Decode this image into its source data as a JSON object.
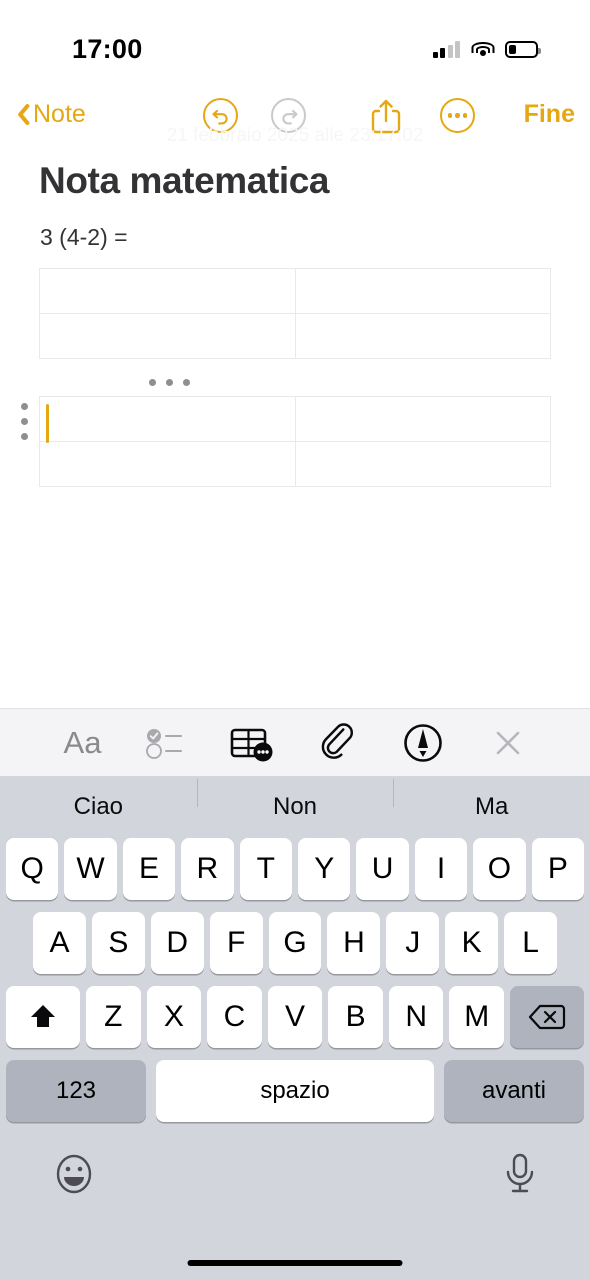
{
  "status_bar": {
    "time": "17:00",
    "signal_icon": "cellular-signal-icon",
    "wifi_icon": "wifi-icon",
    "battery_icon": "battery-low-icon",
    "signal_bars_filled": 2,
    "signal_bars_total": 4,
    "battery_percent": 20
  },
  "nav": {
    "back_label": "Note",
    "back_icon": "chevron-left-icon",
    "undo_icon": "undo-arrow-icon",
    "redo_icon": "redo-arrow-icon",
    "share_icon": "share-square-up-arrow-icon",
    "more_icon": "ellipsis-circle-icon",
    "done_label": "Fine",
    "accent_color": "#e5a812",
    "disabled_color": "#c9c9cb"
  },
  "note": {
    "date": "21 febbraio 2025 alle 23:17:02",
    "title": "Nota matematica",
    "body_line": "3 (4-2) =",
    "tables": [
      {
        "name": "table-1",
        "rows": [
          [
            "",
            ""
          ],
          [
            "",
            ""
          ]
        ]
      },
      {
        "name": "table-2",
        "rows": [
          [
            "",
            ""
          ],
          [
            "",
            ""
          ]
        ]
      }
    ],
    "column_handle_icon": "table-column-handle-dots-icon",
    "row_handle_icon": "table-row-handle-dots-icon",
    "caret_color": "#e5a812",
    "table_border_color": "#e9e9eb"
  },
  "format_toolbar": {
    "items": [
      {
        "label": "Aa",
        "name": "text-format-button",
        "icon": "aa-text-format-icon",
        "state": "inactive"
      },
      {
        "label": "",
        "name": "checklist-button",
        "icon": "checklist-icon",
        "state": "inactive"
      },
      {
        "label": "",
        "name": "table-button",
        "icon": "table-options-icon",
        "state": "active"
      },
      {
        "label": "",
        "name": "attachment-button",
        "icon": "paperclip-icon",
        "state": "inactive"
      },
      {
        "label": "",
        "name": "markup-button",
        "icon": "markup-pen-circle-icon",
        "state": "inactive"
      },
      {
        "label": "",
        "name": "close-toolbar-button",
        "icon": "close-x-icon",
        "state": "inactive"
      }
    ]
  },
  "keyboard": {
    "background_color": "#d2d5db",
    "predictions": [
      "Ciao",
      "Non",
      "Ma"
    ],
    "row1": [
      "Q",
      "W",
      "E",
      "R",
      "T",
      "Y",
      "U",
      "I",
      "O",
      "P"
    ],
    "row2": [
      "A",
      "S",
      "D",
      "F",
      "G",
      "H",
      "J",
      "K",
      "L"
    ],
    "row3_letters": [
      "Z",
      "X",
      "C",
      "V",
      "B",
      "N",
      "M"
    ],
    "shift_icon": "shift-arrow-up-icon",
    "delete_icon": "backspace-delete-icon",
    "numeric_label": "123",
    "space_label": "spazio",
    "next_label": "avanti",
    "emoji_icon": "smiley-face-icon",
    "dictation_icon": "microphone-icon",
    "home_indicator": "home-indicator-bar"
  }
}
